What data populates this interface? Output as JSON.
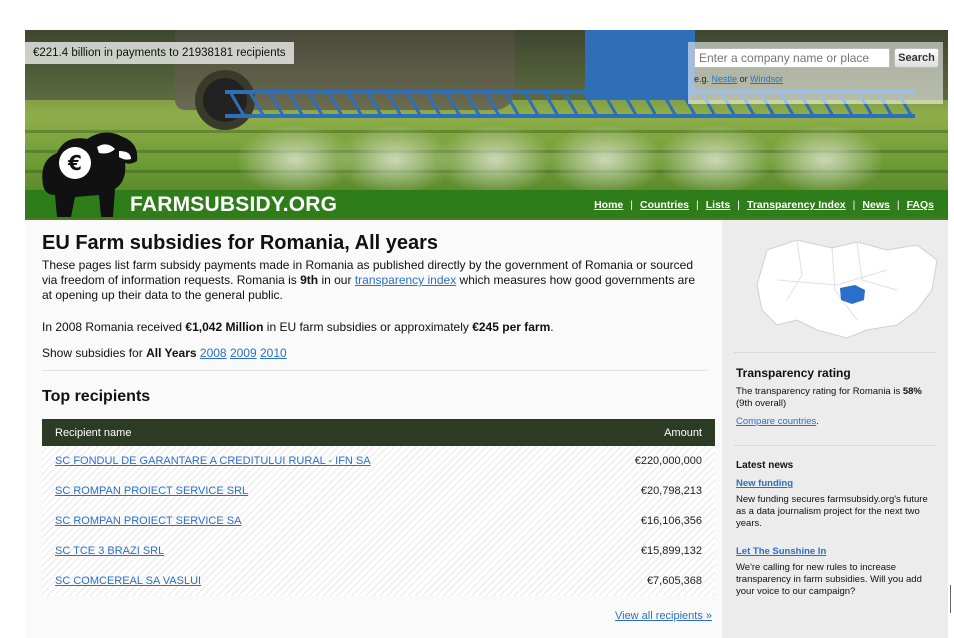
{
  "banner": {
    "stats": "€221.4 billion in payments to 21938181 recipients",
    "search": {
      "placeholder": "Enter a company name or place",
      "button_label": "Search",
      "example_prefix": "e.g.",
      "example_1": "Nestle",
      "example_join": "or",
      "example_2": "Windsor"
    },
    "brand": "FARMSUBSIDY.ORG",
    "nav": [
      "Home",
      "Countries",
      "Lists",
      "Transparency Index",
      "News",
      "FAQs"
    ]
  },
  "main": {
    "title": "EU Farm subsidies for Romania, All years",
    "intro_a": "These pages list farm subsidy payments made in Romania as published directly by the government of Romania or sourced via freedom of information requests. Romania is ",
    "intro_rank": "9th",
    "intro_b": " in our ",
    "intro_link": "transparency index",
    "intro_c": " which measures how good governments are at opening up their data to the general public.",
    "stat_a": "In 2008 Romania received ",
    "stat_total": "€1,042 Million",
    "stat_b": " in EU farm subsidies or approximately ",
    "stat_per_farm": "€245 per farm",
    "stat_c": ".",
    "years_prefix": "Show subsidies for ",
    "years_current": "All Years",
    "years": [
      "2008",
      "2009",
      "2010"
    ],
    "top_heading": "Top recipients",
    "table": {
      "col_name": "Recipient name",
      "col_amount": "Amount",
      "rows": [
        {
          "name": "SC FONDUL DE GARANTARE A CREDITULUI RURAL - IFN SA",
          "amount": "€220,000,000"
        },
        {
          "name": "SC ROMPAN PROIECT SERVICE SRL",
          "amount": "€20,798,213"
        },
        {
          "name": "SC ROMPAN PROIECT SERVICE SA",
          "amount": "€16,106,356"
        },
        {
          "name": "SC TCE 3 BRAZI SRL",
          "amount": "€15,899,132"
        },
        {
          "name": "SC COMCEREAL SA VASLUI",
          "amount": "€7,605,368"
        }
      ]
    },
    "view_all": "View all recipients »"
  },
  "sidebar": {
    "transparency_heading": "Transparency rating",
    "transparency_text_a": "The transparency rating for Romania is ",
    "transparency_pct": "58%",
    "transparency_text_b": " (9th overall)",
    "compare_link": "Compare countries",
    "compare_dot": ".",
    "news_heading": "Latest news",
    "news": [
      {
        "title": "New funding",
        "text": "New funding secures farmsubsidy.org's future as a data journalism project for the next two years."
      },
      {
        "title": "Let The Sunshine In",
        "text": "We're calling for new rules to increase transparency in farm subsidies. Will you add your voice to our campaign?"
      }
    ]
  },
  "colors": {
    "brand_green": "#2e7d1a",
    "table_header": "#2d3a24",
    "link": "#2a6fc9",
    "map_highlight": "#2a6fc9"
  }
}
